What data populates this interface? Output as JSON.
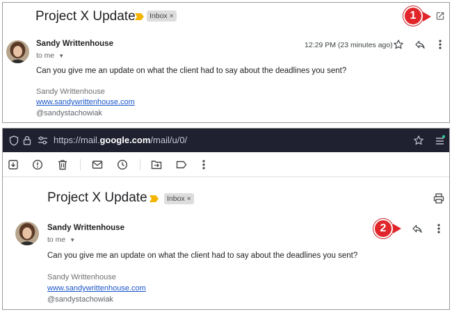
{
  "panel1": {
    "subject": "Project X Update",
    "label_chip": "Inbox",
    "chip_close": "×",
    "sender": "Sandy Writtenhouse",
    "to_me": "to me",
    "timestamp": "12:29 PM (23 minutes ago)",
    "body": "Can you give me an update on what the client had to say about the deadlines you sent?",
    "signature": {
      "name": "Sandy Writtenhouse",
      "link": "www.sandywrittenhouse.com",
      "handle": "@sandystachowiak"
    },
    "callout": "1"
  },
  "panel2": {
    "url_prefix": "https://mail.",
    "url_domain": "google.com",
    "url_suffix": "/mail/u/0/",
    "subject": "Project X Update",
    "label_chip": "Inbox",
    "chip_close": "×",
    "sender": "Sandy Writtenhouse",
    "to_me": "to me",
    "body": "Can you give me an update on what the client had to say about the deadlines you sent?",
    "signature": {
      "name": "Sandy Writtenhouse",
      "link": "www.sandywrittenhouse.com",
      "handle": "@sandystachowiak"
    },
    "callout": "2"
  },
  "colors": {
    "callout_red": "#e0262b",
    "importance_yellow": "#f4b400",
    "urlbar_bg": "#1f2030",
    "link_blue": "#1a55c9"
  }
}
